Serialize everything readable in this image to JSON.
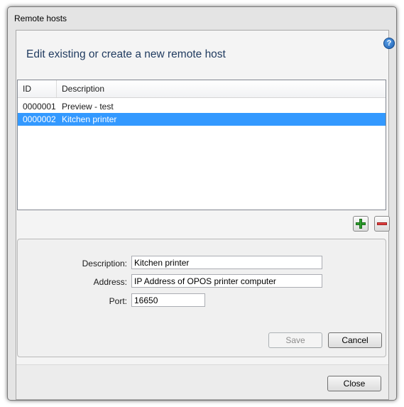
{
  "window": {
    "title": "Remote hosts"
  },
  "help": {
    "glyph": "?"
  },
  "heading": "Edit existing or create a new remote host",
  "hosts_list": {
    "columns": [
      "ID",
      "Description"
    ],
    "rows": [
      {
        "id": "0000001",
        "description": "Preview - test",
        "selected": false
      },
      {
        "id": "0000002",
        "description": "Kitchen printer",
        "selected": true
      }
    ]
  },
  "toolbar": {
    "add_icon": "plus-icon",
    "remove_icon": "minus-icon"
  },
  "form": {
    "description_label": "Description:",
    "description_value": "Kitchen printer",
    "address_label": "Address:",
    "address_value": "IP Address of OPOS printer computer",
    "port_label": "Port:",
    "port_value": "16650",
    "save_label": "Save",
    "cancel_label": "Cancel"
  },
  "footer": {
    "close_label": "Close"
  },
  "colors": {
    "selection": "#3399ff",
    "heading": "#1f3a5f",
    "add": "#2ea12e",
    "remove": "#e04040"
  }
}
